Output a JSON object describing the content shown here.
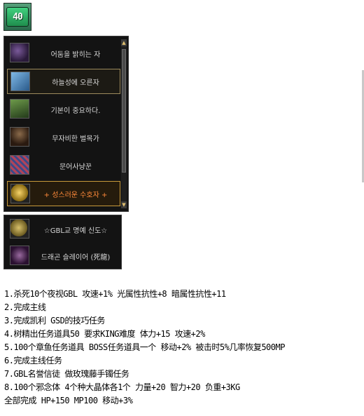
{
  "level_badge": {
    "text": "40",
    "icon": "level-40-badge-icon"
  },
  "title_list": {
    "items": [
      {
        "label": "어둠을 밝히는 자",
        "icon": "moon-portrait-icon",
        "state": "normal"
      },
      {
        "label": "하늘성에 오른자",
        "icon": "tower-icon",
        "state": "selected"
      },
      {
        "label": "기본이 중요하다.",
        "icon": "book-icon",
        "state": "normal"
      },
      {
        "label": "무자비한 벌목가",
        "icon": "tree-icon",
        "state": "normal"
      },
      {
        "label": "문어사냥꾼",
        "icon": "squid-icon",
        "state": "normal"
      },
      {
        "label": "+ 성스러운 수호자 +",
        "icon": "gold-coin-icon",
        "state": "highlighted"
      }
    ],
    "scroll_up": "▲",
    "scroll_down": "▼"
  },
  "title_list_extra": {
    "items": [
      {
        "label": "☆GBL교 명예 신도☆",
        "icon": "coin-icon"
      },
      {
        "label": "드래곤 슬레이어 (死龍)",
        "icon": "dragon-icon"
      }
    ]
  },
  "quest_lines": [
    "1.杀死10个夜视GBL  攻速+1% 光属性抗性+8 暗属性抗性+11",
    "2.完成主线",
    "3.完成凯利 GSD的技巧任务",
    "4.树精出任务道具50 要求KING难度 体力+15 攻速+2%",
    "5.100个章鱼任务道具 BOSS任务道具一个 移动+2% 被击时5%几率恢复500MP",
    "6.完成主线任务",
    "7.GBL名誉信徒 做玫瑰藤手镯任务",
    "8.100个邪念体 4个种大晶体各1个 力量+20 智力+20 负重+3KG",
    "全部完成 HP+150 MP100 移动+3%"
  ]
}
